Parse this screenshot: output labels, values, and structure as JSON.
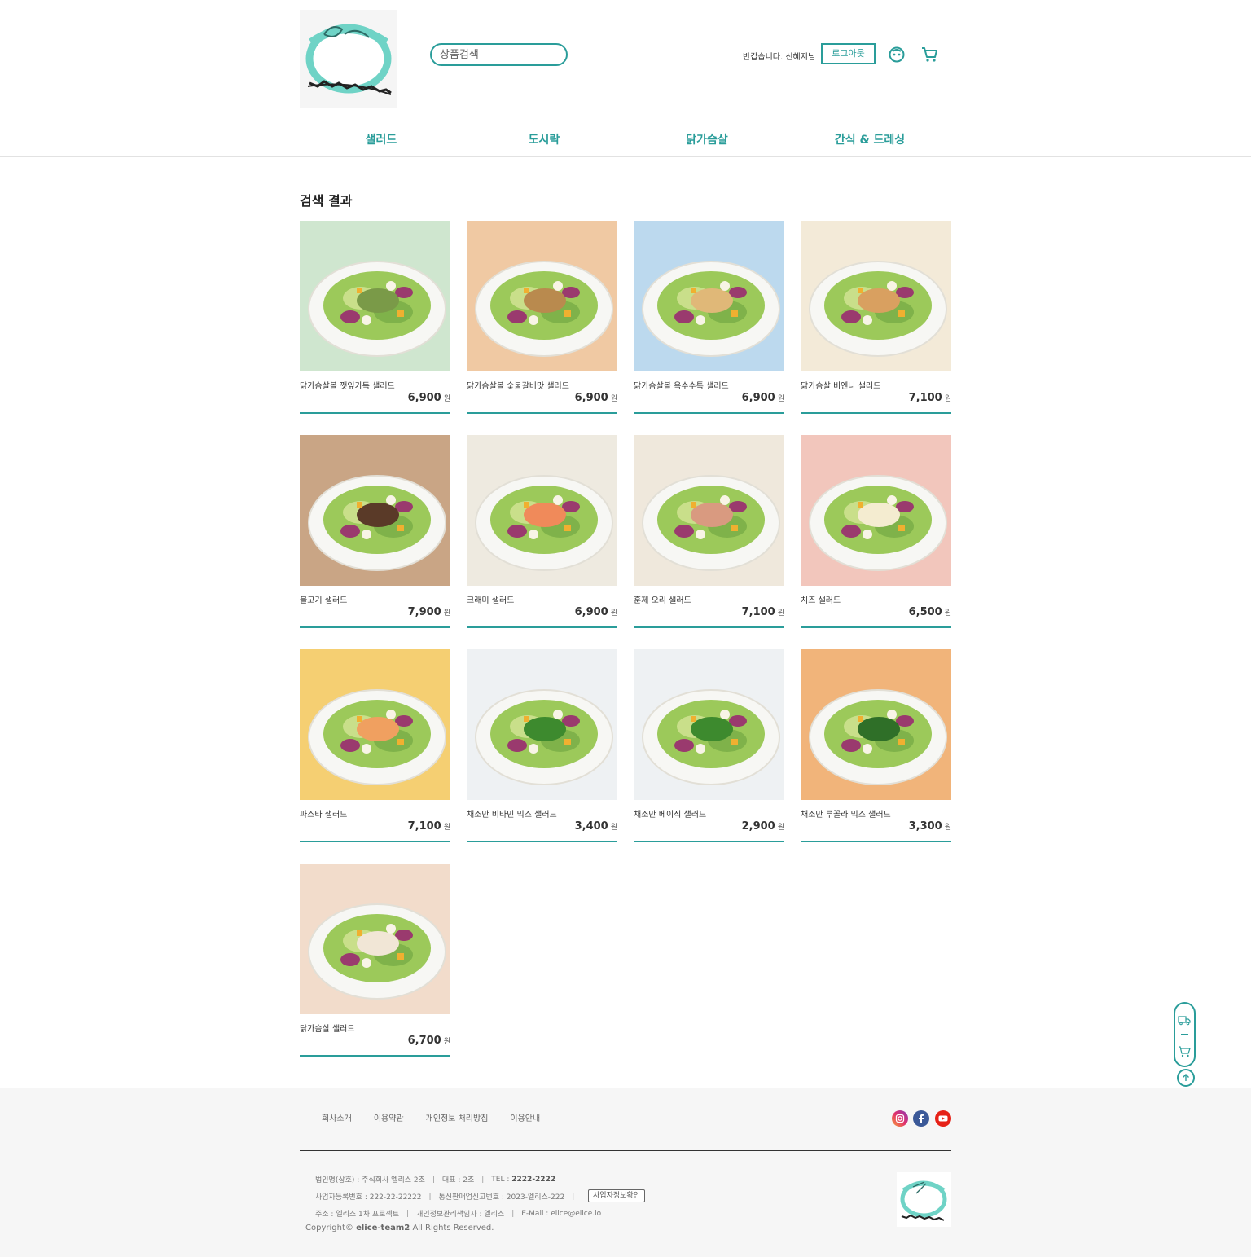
{
  "header": {
    "logo_alt": "Da2Aing salad",
    "search_placeholder": "상품검색",
    "greeting": "반갑습니다. 신혜지님",
    "logout_label": "로그아웃"
  },
  "nav": [
    {
      "label": "샐러드"
    },
    {
      "label": "도시락"
    },
    {
      "label": "닭가슴살"
    },
    {
      "label": "간식 & 드레싱"
    }
  ],
  "main": {
    "title": "검색 결과",
    "currency": "원",
    "products": [
      {
        "name": "닭가슴살볼 깻잎가득 샐러드",
        "price": "6,900",
        "bg": "#cfe6cf",
        "topping": "#7a9a48"
      },
      {
        "name": "닭가슴살볼 숯불갈비맛 샐러드",
        "price": "6,900",
        "bg": "#f0c9a3",
        "topping": "#b98a4e"
      },
      {
        "name": "닭가슴살볼 옥수수톡 샐러드",
        "price": "6,900",
        "bg": "#bcd9ee",
        "topping": "#e0b878"
      },
      {
        "name": "닭가슴살 비엔나 샐러드",
        "price": "7,100",
        "bg": "#f3ead8",
        "topping": "#d9a060"
      },
      {
        "name": "불고기 샐러드",
        "price": "7,900",
        "bg": "#c9a585",
        "topping": "#5a3a28"
      },
      {
        "name": "크래미 샐러드",
        "price": "6,900",
        "bg": "#eeeae0",
        "topping": "#f08a5a"
      },
      {
        "name": "훈제 오리 샐러드",
        "price": "7,100",
        "bg": "#efe8dc",
        "topping": "#d99a80"
      },
      {
        "name": "치즈 샐러드",
        "price": "6,500",
        "bg": "#f2c6bc",
        "topping": "#f4ecd0"
      },
      {
        "name": "파스타 샐러드",
        "price": "7,100",
        "bg": "#f5cf72",
        "topping": "#f0a060"
      },
      {
        "name": "채소만 비타민 믹스 샐러드",
        "price": "3,400",
        "bg": "#eef1f3",
        "topping": "#3d8a2e"
      },
      {
        "name": "채소만 베이직 샐러드",
        "price": "2,900",
        "bg": "#eef1f3",
        "topping": "#3d8a2e"
      },
      {
        "name": "채소만 루꼴라 믹스 샐러드",
        "price": "3,300",
        "bg": "#f1b47a",
        "topping": "#2f6f28"
      },
      {
        "name": "닭가슴살 샐러드",
        "price": "6,700",
        "bg": "#f2dccb",
        "topping": "#f1e6d6"
      }
    ]
  },
  "quick_menu": {
    "icons": [
      "truck-icon",
      "cart-icon",
      "arrow-up-icon",
      "arrow-down-icon"
    ]
  },
  "footer": {
    "links": [
      "회사소개",
      "이용약관",
      "개인정보 처리방침",
      "이용안내"
    ],
    "social": [
      "instagram-icon",
      "facebook-icon",
      "youtube-icon"
    ],
    "info1": {
      "company": "법인명(상호) : 주식회사 엘리스 2조",
      "ceo": "대표 : 2조",
      "tel_label": "TEL :",
      "tel": "2222-2222"
    },
    "info2": {
      "reg": "사업자등록번호 : 222-22-22222",
      "mail_order": "통신판매업신고번호 : 2023-엘리스-222",
      "biz_check": "사업자정보확인"
    },
    "info3": {
      "address": "주소 : 엘리스 1차 프로젝트",
      "privacy": "개인정보관리책임자 : 엘리스",
      "email": "E-Mail : elice@elice.io"
    },
    "copyright_prefix": "Copyright©",
    "copyright_owner": "elice-team2",
    "copyright_suffix": "All Rights Reserved."
  },
  "colors": {
    "accent": "#2a9d9a",
    "footer_bg": "#f6f6f6",
    "logo_teal": "#6fd3c6"
  }
}
